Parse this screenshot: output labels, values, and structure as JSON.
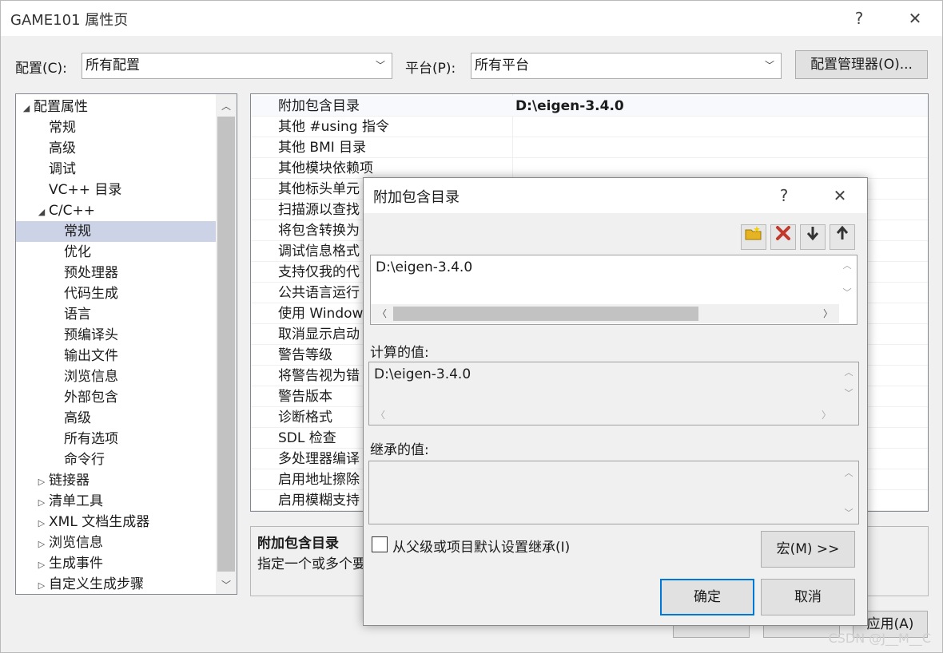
{
  "window": {
    "title": "GAME101 属性页",
    "help": "?",
    "close": "✕"
  },
  "config": {
    "config_label": "配置(C):",
    "config_value": "所有配置",
    "platform_label": "平台(P):",
    "platform_value": "所有平台",
    "manager_button": "配置管理器(O)..."
  },
  "tree": {
    "items": [
      {
        "label": "配置属性",
        "arrow": "◢",
        "indent": 0
      },
      {
        "label": "常规",
        "arrow": "",
        "indent": 1
      },
      {
        "label": "高级",
        "arrow": "",
        "indent": 1
      },
      {
        "label": "调试",
        "arrow": "",
        "indent": 1
      },
      {
        "label": "VC++ 目录",
        "arrow": "",
        "indent": 1
      },
      {
        "label": "C/C++",
        "arrow": "◢",
        "indent": 1
      },
      {
        "label": "常规",
        "arrow": "",
        "indent": 2,
        "selected": true
      },
      {
        "label": "优化",
        "arrow": "",
        "indent": 2
      },
      {
        "label": "预处理器",
        "arrow": "",
        "indent": 2
      },
      {
        "label": "代码生成",
        "arrow": "",
        "indent": 2
      },
      {
        "label": "语言",
        "arrow": "",
        "indent": 2
      },
      {
        "label": "预编译头",
        "arrow": "",
        "indent": 2
      },
      {
        "label": "输出文件",
        "arrow": "",
        "indent": 2
      },
      {
        "label": "浏览信息",
        "arrow": "",
        "indent": 2
      },
      {
        "label": "外部包含",
        "arrow": "",
        "indent": 2
      },
      {
        "label": "高级",
        "arrow": "",
        "indent": 2
      },
      {
        "label": "所有选项",
        "arrow": "",
        "indent": 2
      },
      {
        "label": "命令行",
        "arrow": "",
        "indent": 2
      },
      {
        "label": "链接器",
        "arrow": "▷",
        "indent": 1
      },
      {
        "label": "清单工具",
        "arrow": "▷",
        "indent": 1
      },
      {
        "label": "XML 文档生成器",
        "arrow": "▷",
        "indent": 1
      },
      {
        "label": "浏览信息",
        "arrow": "▷",
        "indent": 1
      },
      {
        "label": "生成事件",
        "arrow": "▷",
        "indent": 1
      },
      {
        "label": "自定义生成步骤",
        "arrow": "▷",
        "indent": 1
      }
    ]
  },
  "grid": {
    "rows": [
      {
        "name": "附加包含目录",
        "value": "D:\\eigen-3.4.0"
      },
      {
        "name": "其他 #using 指令",
        "value": ""
      },
      {
        "name": "其他 BMI 目录",
        "value": ""
      },
      {
        "name": "其他模块依赖项",
        "value": ""
      },
      {
        "name": "其他标头单元",
        "value": ""
      },
      {
        "name": "扫描源以查找",
        "value": ""
      },
      {
        "name": "将包含转换为",
        "value": ""
      },
      {
        "name": "调试信息格式",
        "value": ""
      },
      {
        "name": "支持仅我的代",
        "value": ""
      },
      {
        "name": "公共语言运行",
        "value": ""
      },
      {
        "name": "使用 Window",
        "value": ""
      },
      {
        "name": "取消显示启动",
        "value": ""
      },
      {
        "name": "警告等级",
        "value": ""
      },
      {
        "name": "将警告视为错",
        "value": ""
      },
      {
        "name": "警告版本",
        "value": ""
      },
      {
        "name": "诊断格式",
        "value": ""
      },
      {
        "name": "SDL 检查",
        "value": ""
      },
      {
        "name": "多处理器编译",
        "value": ""
      },
      {
        "name": "启用地址擦除",
        "value": ""
      },
      {
        "name": "启用模糊支持",
        "value": ""
      }
    ]
  },
  "description": {
    "title": "附加包含目录",
    "text": "指定一个或多个要"
  },
  "bottom_buttons": {
    "apply": "应用(A)"
  },
  "watermark": "CSDN @J__M__C",
  "dialog": {
    "title": "附加包含目录",
    "help": "?",
    "close": "✕",
    "entry": "D:\\eigen-3.4.0",
    "computed_label": "计算的值:",
    "computed_value": "D:\\eigen-3.4.0",
    "inherited_label": "继承的值:",
    "inherit_checkbox_label": "从父级或项目默认设置继承(I)",
    "macro_button": "宏(M) >>",
    "ok_button": "确定",
    "cancel_button": "取消"
  },
  "colors": {
    "delete_icon": "#c0392b",
    "folder_icon": "#e6b422",
    "primary_border": "#0078d7"
  }
}
